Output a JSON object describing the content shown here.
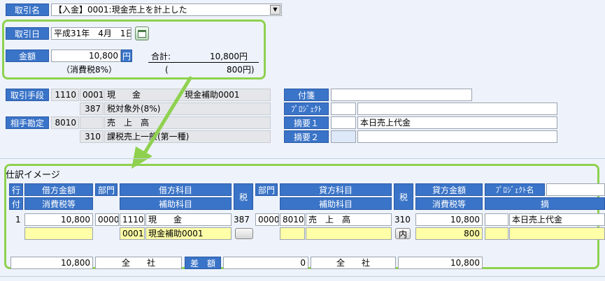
{
  "header": {
    "torihiki_name_label": "取引名",
    "torihiki_name_value": "【入金】0001:現金売上を計上した"
  },
  "entry": {
    "date_label": "取引日",
    "date_value": "平成31年　4月　1日",
    "amount_label": "金額",
    "amount_value": "10,800",
    "amount_unit": "円",
    "total_label": "合計:",
    "total_value": "10,800円",
    "tax_label": "（消費税8%）",
    "tax_paren_open": "(",
    "tax_value": "800円)"
  },
  "means": {
    "label": "取引手段",
    "code1": "1110",
    "code2": "0001",
    "account": "現　　金",
    "sub_account": "現金補助0001",
    "tax_code": "387",
    "tax_name": "税対象外(8%)"
  },
  "counter": {
    "label": "相手勘定",
    "code1": "8010",
    "account": "売　上　高",
    "tax_code": "310",
    "tax_name": "課税売上一般(第一種)"
  },
  "right_panel": {
    "fusen_label": "付箋",
    "project_label": "ﾌﾟﾛｼﾞｪｸﾄ",
    "memo1_label": "摘要１",
    "memo1_value": "本日売上代金",
    "memo2_label": "摘要２"
  },
  "journal": {
    "section_title": "仕訳イメージ",
    "headers": {
      "gyo": "行",
      "fu": "付",
      "debit_amount": "借方金額",
      "debit_tax": "消費税等",
      "dept1": "部門",
      "debit_account": "借方科目",
      "debit_sub": "補助科目",
      "tax1": "税",
      "dept2": "部門",
      "credit_account": "貸方科目",
      "credit_sub": "補助科目",
      "tax2": "税",
      "credit_amount": "貸方金額",
      "credit_tax": "消費税等",
      "project": "ﾌﾟﾛｼﾞｪｸﾄ名",
      "memo": "摘"
    },
    "row": {
      "line_no": "1",
      "debit_amount": "10,800",
      "debit_dept": "0000",
      "debit_code": "1110",
      "debit_account": "現　　金",
      "debit_sub_code": "0001",
      "debit_sub": "現金補助0001",
      "debit_tax_code": "387",
      "credit_dept": "0000",
      "credit_code": "8010",
      "credit_account": "売　上　高",
      "credit_tax_code": "310",
      "credit_tax_button": "内",
      "credit_amount": "10,800",
      "credit_tax": "800",
      "memo": "本日売上代金"
    },
    "footer": {
      "debit_total": "10,800",
      "scope1": "全　　社",
      "diff_label": "差　額",
      "diff_value": "0",
      "scope2": "全　　社",
      "credit_total": "10,800"
    }
  },
  "colors": {
    "label_blue": "#3a74c8",
    "highlight_green": "#8fd14f",
    "input_yellow": "#ffffa8"
  }
}
